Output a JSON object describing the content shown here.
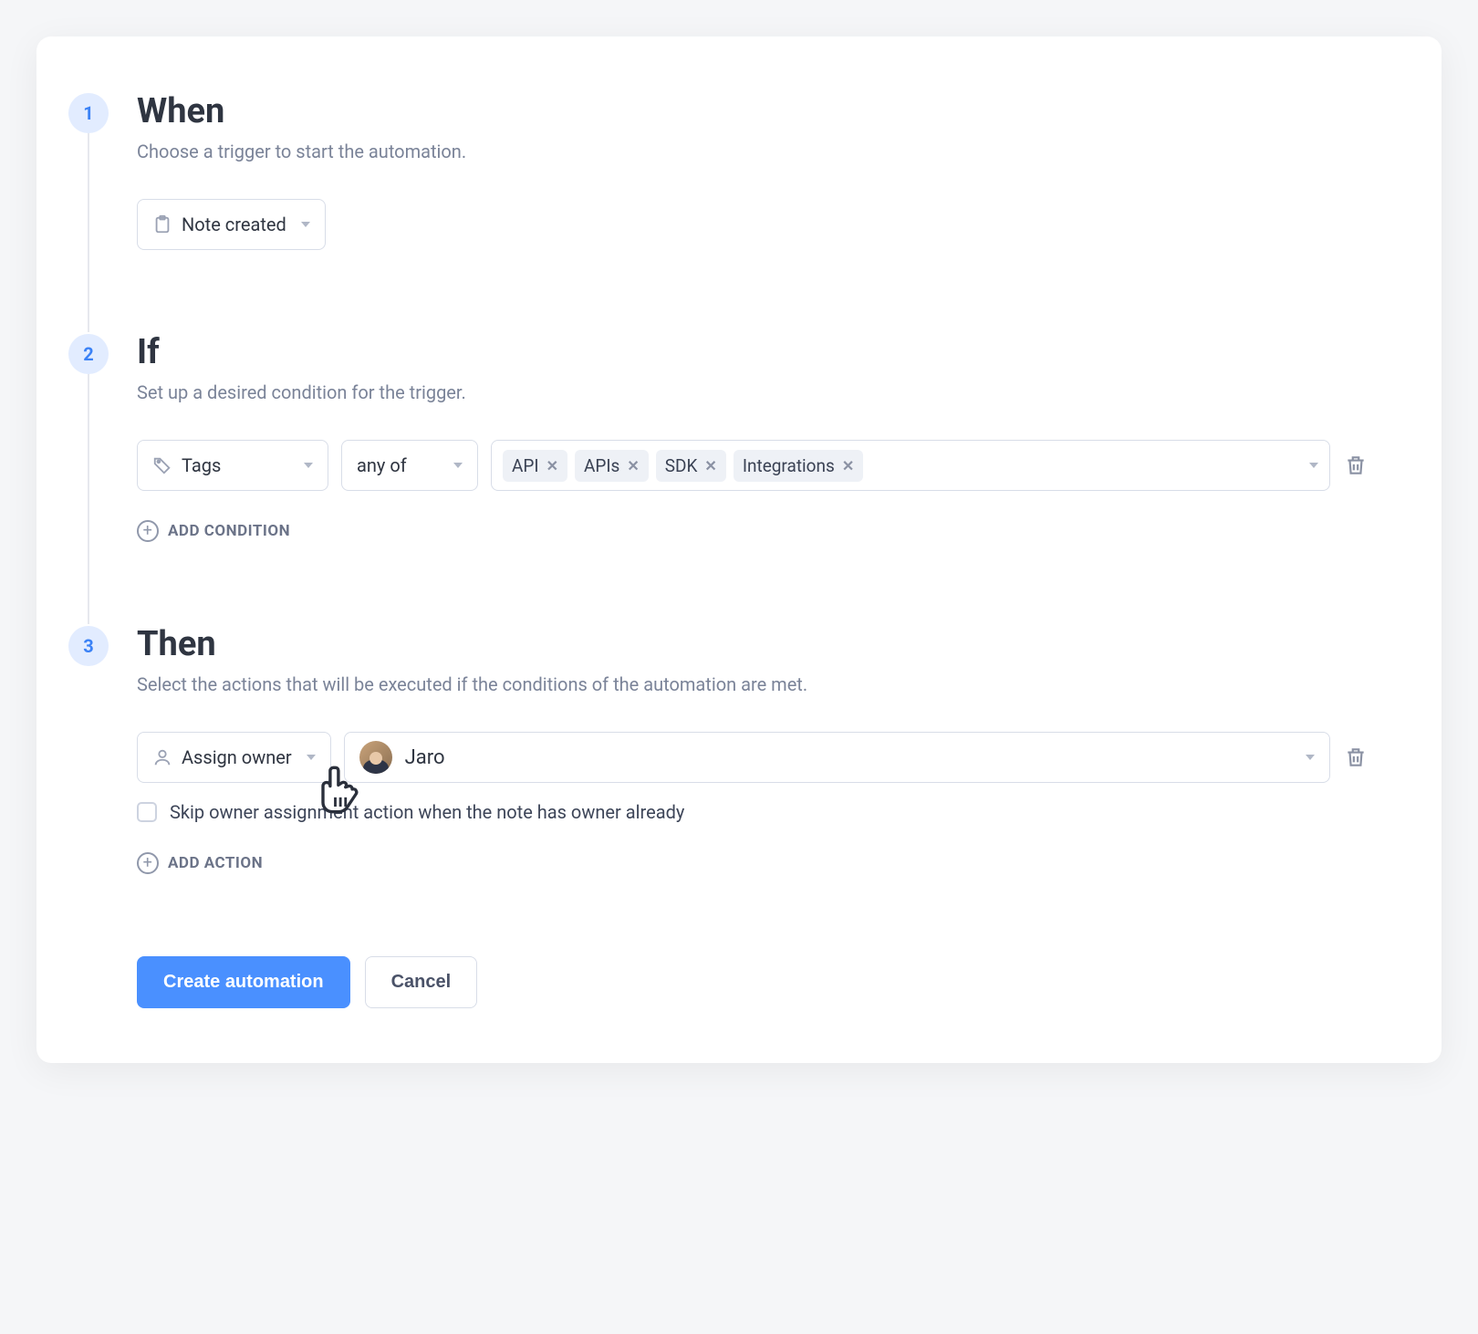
{
  "steps": {
    "when": {
      "number": "1",
      "title": "When",
      "desc": "Choose a trigger to start the automation.",
      "trigger_label": "Note created"
    },
    "if": {
      "number": "2",
      "title": "If",
      "desc": "Set up a desired condition for the trigger.",
      "field_label": "Tags",
      "operator_label": "any of",
      "tags": [
        "API",
        "APIs",
        "SDK",
        "Integrations"
      ],
      "add_condition_label": "ADD CONDITION"
    },
    "then": {
      "number": "3",
      "title": "Then",
      "desc": "Select the actions that will be executed if the conditions of the automation are met.",
      "action_label": "Assign owner",
      "owner_name": "Jaro",
      "skip_label": "Skip owner assignment action when the note has owner already",
      "add_action_label": "ADD ACTION"
    }
  },
  "buttons": {
    "create": "Create automation",
    "cancel": "Cancel"
  }
}
